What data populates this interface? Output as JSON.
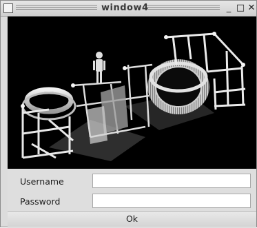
{
  "window": {
    "title": "window4",
    "minimize_glyph": "_",
    "maximize_glyph": "□",
    "close_glyph": "✕"
  },
  "viewport": {
    "content": "3D wireframe machine scene with figure, scaffolding and gear"
  },
  "form": {
    "username_label": "Username",
    "username_value": "",
    "password_label": "Password",
    "password_value": "",
    "ok_label": "Ok"
  },
  "colors": {
    "window_bg": "#dcdcdc",
    "viewport_bg": "#000000",
    "field_bg": "#ffffff"
  }
}
